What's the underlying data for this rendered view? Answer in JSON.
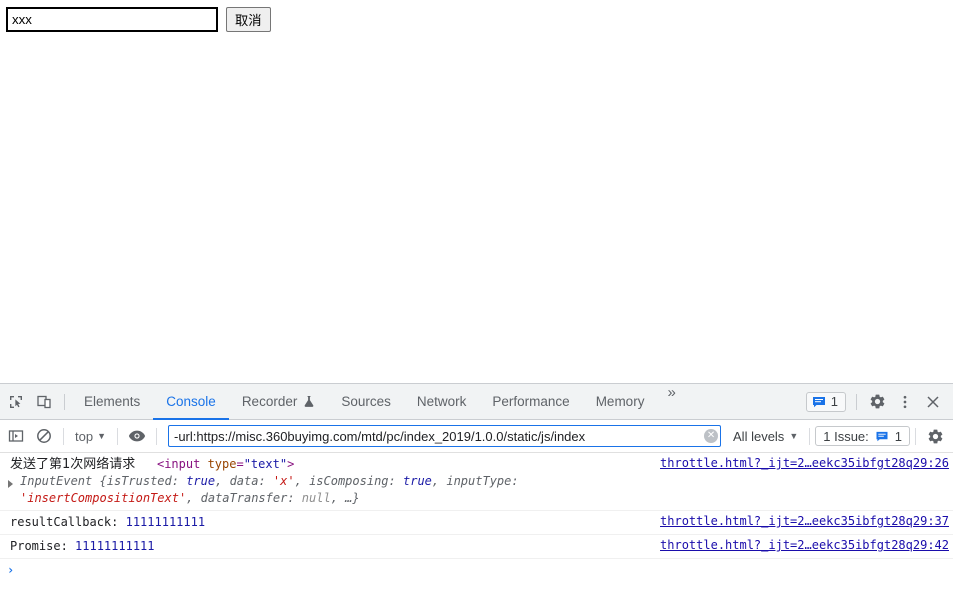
{
  "page": {
    "input_value": "xxx",
    "input_placeholder": "",
    "cancel_label": "取消"
  },
  "devtools": {
    "toolbar_icons": [
      {
        "name": "inspect-element-icon",
        "title": "Inspect element"
      },
      {
        "name": "device-toolbar-icon",
        "title": "Toggle device toolbar"
      }
    ],
    "tabs": [
      {
        "label": "Elements",
        "selected": false,
        "icon": ""
      },
      {
        "label": "Console",
        "selected": true,
        "icon": ""
      },
      {
        "label": "Recorder",
        "selected": false,
        "icon": "flask-icon"
      },
      {
        "label": "Sources",
        "selected": false,
        "icon": ""
      },
      {
        "label": "Network",
        "selected": false,
        "icon": ""
      },
      {
        "label": "Performance",
        "selected": false,
        "icon": ""
      },
      {
        "label": "Memory",
        "selected": false,
        "icon": ""
      }
    ],
    "more_tabs_label": "»",
    "issues_badge_count": "1",
    "settings_label": "Settings",
    "more_options_label": "More options",
    "close_label": "Close",
    "accent_color": "#1a73e8"
  },
  "console_toolbar": {
    "sidebar_toggle_name": "console-sidebar-toggle",
    "clear_console_name": "clear-console-icon",
    "context_selector": "top",
    "context_caret": "▼",
    "eye_icon_name": "live-expression-eye-icon",
    "filter_value": "-url:https://misc.360buyimg.com/mtd/pc/index_2019/1.0.0/static/js/index",
    "filter_placeholder": "Filter",
    "clear_filter_glyph": "✕",
    "levels_label": "All levels",
    "levels_caret": "▼",
    "issue_chip_label": "1 Issue:",
    "issue_chip_count": "1",
    "settings_label": "Console settings"
  },
  "console_messages": [
    {
      "id": "msg-1",
      "type": "log",
      "expandable": false,
      "text_cjk": "发送了第1次网络请求",
      "dom_node": {
        "lt": "<",
        "tag": "input",
        "space": " ",
        "attr": "type",
        "eq": "=",
        "val": "\"text\"",
        "gt": ">"
      },
      "source": "throttle.html?_ijt=2…eekc35ibfgt28q29:26"
    },
    {
      "id": "msg-2",
      "type": "object",
      "expandable": true,
      "ctor": "InputEvent",
      "open_brace": "{",
      "props": [
        {
          "key": "isTrusted",
          "value": "true",
          "kind": "bool"
        },
        {
          "key": "data",
          "value": "'x'",
          "kind": "str"
        },
        {
          "key": "isComposing",
          "value": "true",
          "kind": "bool"
        },
        {
          "key": "inputType",
          "value": "'insertCompositionText'",
          "kind": "str"
        },
        {
          "key": "dataTransfer",
          "value": "null",
          "kind": "null"
        }
      ],
      "ellipsis": "…",
      "close_brace": "}",
      "source": ""
    },
    {
      "id": "msg-3",
      "type": "log",
      "expandable": false,
      "label": "resultCallback:",
      "value": "11111111111",
      "source": "throttle.html?_ijt=2…eekc35ibfgt28q29:37"
    },
    {
      "id": "msg-4",
      "type": "log",
      "expandable": false,
      "label": "Promise:",
      "value": "11111111111",
      "source": "throttle.html?_ijt=2…eekc35ibfgt28q29:42"
    }
  ],
  "prompt": {
    "chevron": "›",
    "value": ""
  }
}
